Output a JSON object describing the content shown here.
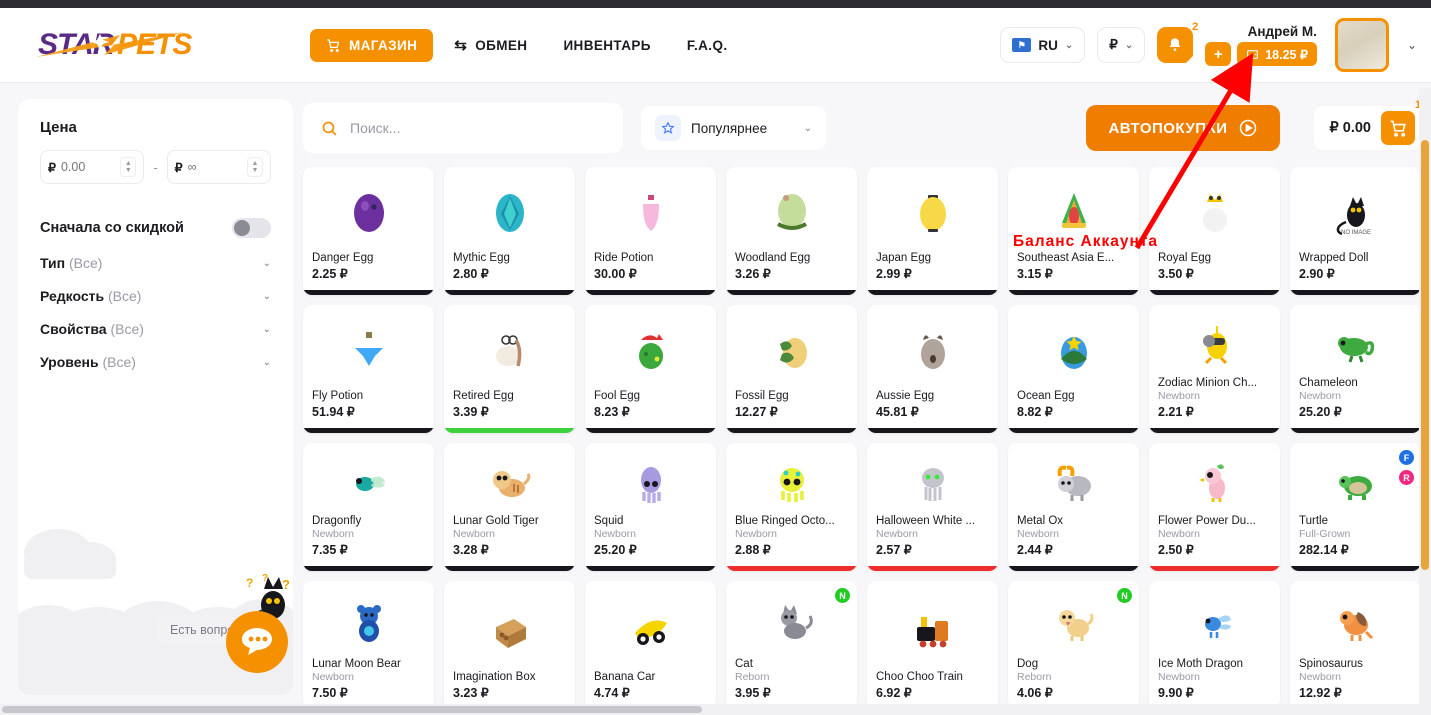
{
  "header": {
    "logo_text": "STARPETS",
    "nav": [
      {
        "label": "МАГАЗИН",
        "icon": "shopping-cart-icon",
        "active": true
      },
      {
        "label": "ОБМЕН",
        "icon": "exchange-icon",
        "active": false
      },
      {
        "label": "ИНВЕНТАРЬ",
        "icon": "",
        "active": false
      },
      {
        "label": "F.A.Q.",
        "icon": "",
        "active": false
      }
    ],
    "language": {
      "label": "RU",
      "icon": "flag-icon"
    },
    "currency": {
      "label": "₽",
      "icon": "ruble-icon"
    },
    "notifications": {
      "count": "2",
      "icon": "bell-icon"
    },
    "user_name": "Андрей М.",
    "add_funds_label": "+",
    "balance": "18.25 ₽",
    "balance_icon": "wallet-icon",
    "account_chevron": "chevron-down-icon"
  },
  "sidebar": {
    "price_title": "Цена",
    "price_min_placeholder": "0.00",
    "price_min_value": "",
    "price_max_placeholder": "∞",
    "price_max_value": "",
    "currency_symbol": "₽",
    "range_dash": "-",
    "discount_label": "Сначала со скидкой",
    "discount_enabled": false,
    "filters": [
      {
        "label": "Тип",
        "value": "(Все)"
      },
      {
        "label": "Редкость",
        "value": "(Все)"
      },
      {
        "label": "Свойства",
        "value": "(Все)"
      },
      {
        "label": "Уровень",
        "value": "(Все)"
      }
    ],
    "chat_tooltip": "Есть вопрос?"
  },
  "toolbar": {
    "search_placeholder": "Поиск...",
    "search_value": "",
    "search_icon": "search-icon",
    "sort_label": "Популярнее",
    "sort_icon": "star-icon",
    "autopurchase_label": "АВТОПОКУПКИ",
    "autopurchase_icon": "play-circle-icon",
    "cart_total": "₽ 0.00",
    "cart_count": "1",
    "cart_icon": "shopping-cart-icon"
  },
  "annotation": {
    "text": "Баланс Аккаунта",
    "color": "#ff0000"
  },
  "products": [
    {
      "name": "Danger Egg",
      "sub": "",
      "price": "2.25 ₽",
      "bar": "dark",
      "badges": [],
      "icon": "egg-purple"
    },
    {
      "name": "Mythic Egg",
      "sub": "",
      "price": "2.80 ₽",
      "bar": "dark",
      "badges": [],
      "icon": "egg-teal"
    },
    {
      "name": "Ride Potion",
      "sub": "",
      "price": "30.00 ₽",
      "bar": "dark",
      "badges": [],
      "icon": "potion-pink"
    },
    {
      "name": "Woodland Egg",
      "sub": "",
      "price": "3.26 ₽",
      "bar": "dark",
      "badges": [],
      "icon": "egg-green"
    },
    {
      "name": "Japan Egg",
      "sub": "",
      "price": "2.99 ₽",
      "bar": "dark",
      "badges": [],
      "icon": "egg-yellow"
    },
    {
      "name": "Southeast Asia E...",
      "sub": "",
      "price": "3.15 ₽",
      "bar": "dark",
      "badges": [],
      "icon": "egg-rainbow"
    },
    {
      "name": "Royal Egg",
      "sub": "",
      "price": "3.50 ₽",
      "bar": "dark",
      "badges": [],
      "icon": "egg-crown"
    },
    {
      "name": "Wrapped Doll",
      "sub": "",
      "price": "2.90 ₽",
      "bar": "dark",
      "badges": [],
      "icon": "no-image-cat"
    },
    {
      "name": "Fly Potion",
      "sub": "",
      "price": "51.94 ₽",
      "bar": "dark",
      "badges": [],
      "icon": "potion-blue"
    },
    {
      "name": "Retired Egg",
      "sub": "",
      "price": "3.39 ₽",
      "bar": "green",
      "badges": [],
      "icon": "egg-retired"
    },
    {
      "name": "Fool Egg",
      "sub": "",
      "price": "8.23 ₽",
      "bar": "dark",
      "badges": [],
      "icon": "egg-fool"
    },
    {
      "name": "Fossil Egg",
      "sub": "",
      "price": "12.27 ₽",
      "bar": "dark",
      "badges": [],
      "icon": "egg-fossil"
    },
    {
      "name": "Aussie Egg",
      "sub": "",
      "price": "45.81 ₽",
      "bar": "dark",
      "badges": [],
      "icon": "egg-aussie"
    },
    {
      "name": "Ocean Egg",
      "sub": "",
      "price": "8.82 ₽",
      "bar": "dark",
      "badges": [],
      "icon": "egg-ocean"
    },
    {
      "name": "Zodiac Minion Ch...",
      "sub": "Newborn",
      "price": "2.21 ₽",
      "bar": "dark",
      "badges": [],
      "icon": "minion-chick"
    },
    {
      "name": "Chameleon",
      "sub": "Newborn",
      "price": "25.20 ₽",
      "bar": "dark",
      "badges": [],
      "icon": "chameleon"
    },
    {
      "name": "Dragonfly",
      "sub": "Newborn",
      "price": "7.35 ₽",
      "bar": "dark",
      "badges": [],
      "icon": "dragonfly"
    },
    {
      "name": "Lunar Gold Tiger",
      "sub": "Newborn",
      "price": "3.28 ₽",
      "bar": "dark",
      "badges": [],
      "icon": "tiger"
    },
    {
      "name": "Squid",
      "sub": "Newborn",
      "price": "25.20 ₽",
      "bar": "dark",
      "badges": [],
      "icon": "squid"
    },
    {
      "name": "Blue Ringed Octo...",
      "sub": "Newborn",
      "price": "2.88 ₽",
      "bar": "red",
      "badges": [],
      "icon": "octopus"
    },
    {
      "name": "Halloween White ...",
      "sub": "Newborn",
      "price": "2.57 ₽",
      "bar": "red",
      "badges": [],
      "icon": "ghost-octopus"
    },
    {
      "name": "Metal Ox",
      "sub": "Newborn",
      "price": "2.44 ₽",
      "bar": "dark",
      "badges": [],
      "icon": "ox"
    },
    {
      "name": "Flower Power Du...",
      "sub": "Newborn",
      "price": "2.50 ₽",
      "bar": "red",
      "badges": [],
      "icon": "duck-flower"
    },
    {
      "name": "Turtle",
      "sub": "Full-Grown",
      "price": "282.14 ₽",
      "bar": "dark",
      "badges": [
        "F",
        "R"
      ],
      "icon": "turtle"
    },
    {
      "name": "Lunar Moon Bear",
      "sub": "Newborn",
      "price": "7.50 ₽",
      "bar": "none",
      "badges": [],
      "icon": "bear"
    },
    {
      "name": "Imagination Box",
      "sub": "",
      "price": "3.23 ₽",
      "bar": "none",
      "badges": [],
      "icon": "box"
    },
    {
      "name": "Banana Car",
      "sub": "",
      "price": "4.74 ₽",
      "bar": "none",
      "badges": [],
      "icon": "banana-car"
    },
    {
      "name": "Cat",
      "sub": "Reborn",
      "price": "3.95 ₽",
      "bar": "none",
      "badges": [
        "N"
      ],
      "icon": "cat-grey"
    },
    {
      "name": "Choo Choo Train",
      "sub": "",
      "price": "6.92 ₽",
      "bar": "none",
      "badges": [],
      "icon": "train"
    },
    {
      "name": "Dog",
      "sub": "Reborn",
      "price": "4.06 ₽",
      "bar": "none",
      "badges": [
        "N"
      ],
      "icon": "dog"
    },
    {
      "name": "Ice Moth Dragon",
      "sub": "Newborn",
      "price": "9.90 ₽",
      "bar": "none",
      "badges": [],
      "icon": "ice-dragon"
    },
    {
      "name": "Spinosaurus",
      "sub": "Newborn",
      "price": "12.92 ₽",
      "bar": "none",
      "badges": [],
      "icon": "spinosaurus"
    }
  ]
}
